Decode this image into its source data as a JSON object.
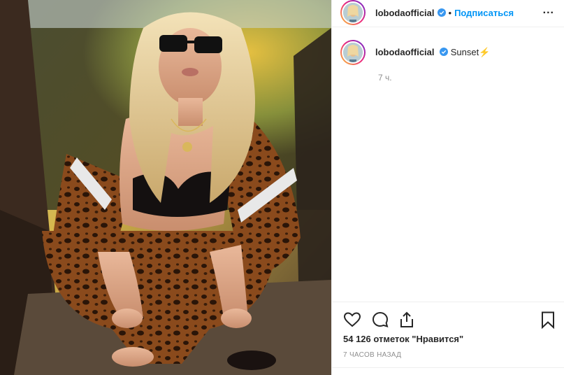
{
  "post": {
    "username": "lobodaofficial",
    "follow_label": "Подписаться",
    "separator": "•",
    "more_label": "...",
    "caption_user": "lobodaofficial",
    "caption_text": "Sunset",
    "caption_emoji": "⚡",
    "caption_time": "7 ч.",
    "likes": "54 126 отметок \"Нравится\"",
    "date": "7 ЧАСОВ НАЗАД"
  },
  "icons": {
    "like": "heart-icon",
    "comment": "comment-icon",
    "share": "share-icon",
    "save": "bookmark-icon",
    "verified": "verified-badge-icon"
  },
  "colors": {
    "accent": "#0095f6",
    "text": "#262626",
    "muted": "#8e8e8e",
    "verified": "#3897f0"
  }
}
